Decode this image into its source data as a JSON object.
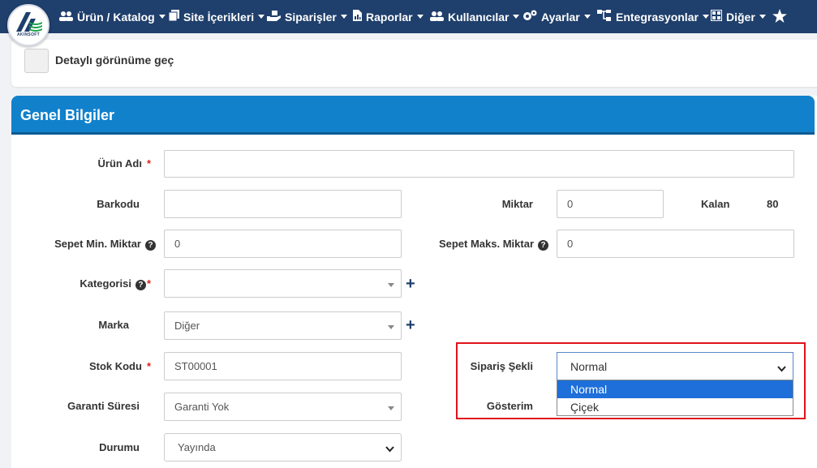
{
  "brand": {
    "logo_text": "AKINSOFT"
  },
  "nav": {
    "items": [
      {
        "label": "Ürün / Katalog",
        "icon": "users-icon"
      },
      {
        "label": "Site İçerikleri",
        "icon": "copy-icon"
      },
      {
        "label": "Siparişler",
        "icon": "hand-box-icon"
      },
      {
        "label": "Raporlar",
        "icon": "report-icon"
      },
      {
        "label": "Kullanıcılar",
        "icon": "users-icon"
      },
      {
        "label": "Ayarlar",
        "icon": "gears-icon"
      },
      {
        "label": "Entegrasyonlar",
        "icon": "sitemap-icon"
      },
      {
        "label": "Diğer",
        "icon": "grid-icon"
      }
    ],
    "favorite_icon": "star-icon"
  },
  "detail_toggle": {
    "label": "Detaylı görünüme geç",
    "checked": false
  },
  "card": {
    "title": "Genel Bilgiler"
  },
  "form": {
    "urun_adi": {
      "label": "Ürün Adı",
      "required": "*",
      "value": ""
    },
    "barkodu": {
      "label": "Barkodu",
      "value": ""
    },
    "miktar": {
      "label": "Miktar",
      "value": "0"
    },
    "kalan": {
      "label": "Kalan",
      "value": "80"
    },
    "sepet_min": {
      "label": "Sepet Min. Miktar",
      "help": "?",
      "value": "0"
    },
    "sepet_maks": {
      "label": "Sepet Maks. Miktar",
      "help": "?",
      "value": "0"
    },
    "kategorisi": {
      "label": "Kategorisi",
      "help": "?",
      "required": "*",
      "value": "",
      "add": "+"
    },
    "marka": {
      "label": "Marka",
      "value": "Diğer",
      "add": "+"
    },
    "stok_kodu": {
      "label": "Stok Kodu",
      "required": "*",
      "value": "ST00001"
    },
    "siparis_sekli": {
      "label": "Sipariş Şekli",
      "value": "Normal",
      "options": [
        "Normal",
        "Çiçek"
      ],
      "highlighted_option": "Normal"
    },
    "garanti_suresi": {
      "label": "Garanti Süresi",
      "value": "Garanti Yok"
    },
    "gosterim": {
      "label": "Gösterim"
    },
    "durumu": {
      "label": "Durumu",
      "value": "Yayında"
    }
  },
  "colors": {
    "nav_bg": "#1f3f6c",
    "header_bg": "#1181cc",
    "highlight": "#e0121b",
    "option_active": "#1e6fd9",
    "required": "#d9241c"
  }
}
